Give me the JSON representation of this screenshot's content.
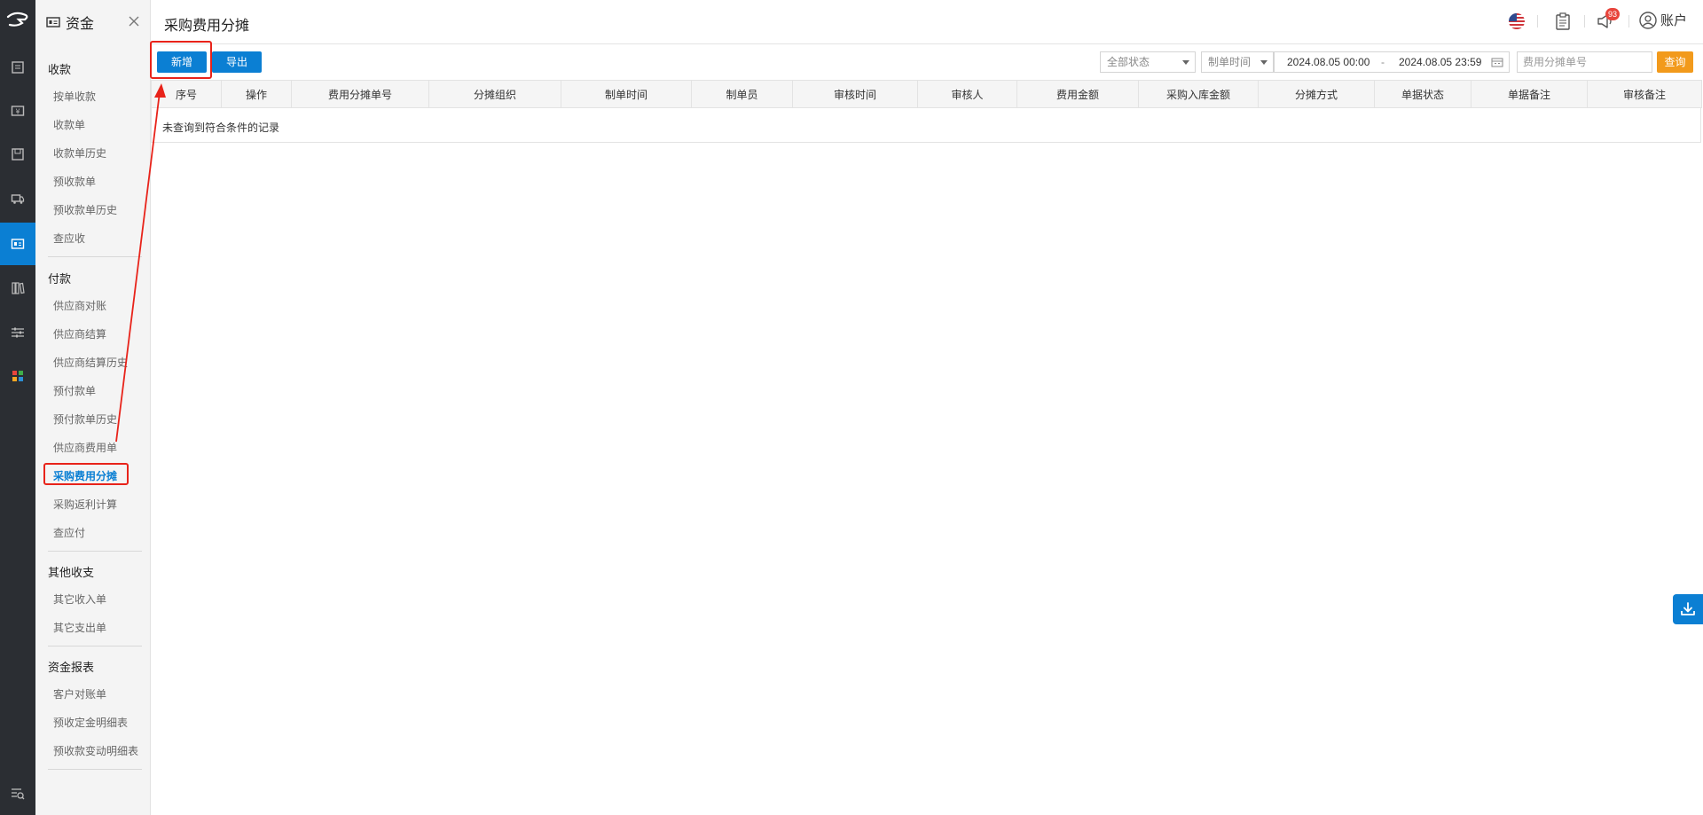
{
  "module": {
    "title": "资金"
  },
  "submenu": {
    "groups": [
      {
        "label": "收款",
        "items": [
          "按单收款",
          "收款单",
          "收款单历史",
          "预收款单",
          "预收款单历史",
          "查应收"
        ]
      },
      {
        "label": "付款",
        "items": [
          "供应商对账",
          "供应商结算",
          "供应商结算历史",
          "预付款单",
          "预付款单历史",
          "供应商费用单",
          "采购费用分摊",
          "采购返利计算",
          "查应付"
        ]
      },
      {
        "label": "其他收支",
        "items": [
          "其它收入单",
          "其它支出单"
        ]
      },
      {
        "label": "资金报表",
        "items": [
          "客户对账单",
          "预收定金明细表",
          "预收款变动明细表"
        ]
      }
    ],
    "current": "采购费用分摊"
  },
  "header": {
    "page_title": "采购费用分摊",
    "notification_count": "93",
    "account_label": "账户"
  },
  "toolbar": {
    "add_label": "新增",
    "export_label": "导出",
    "status_value": "全部状态",
    "time_type_value": "制单时间",
    "date_start": "2024.08.05 00:00",
    "date_sep": "-",
    "date_end": "2024.08.05 23:59",
    "search_placeholder": "费用分摊单号",
    "query_label": "查询"
  },
  "table": {
    "columns": [
      "序号",
      "操作",
      "费用分摊单号",
      "分摊组织",
      "制单时间",
      "制单员",
      "审核时间",
      "审核人",
      "费用金额",
      "采购入库金额",
      "分摊方式",
      "单据状态",
      "单据备注",
      "审核备注"
    ],
    "empty_text": "未查询到符合条件的记录"
  },
  "colors": {
    "primary": "#0b7fd3",
    "query": "#f29a1c",
    "highlight": "#e8231a",
    "rail": "#2b2e33"
  }
}
